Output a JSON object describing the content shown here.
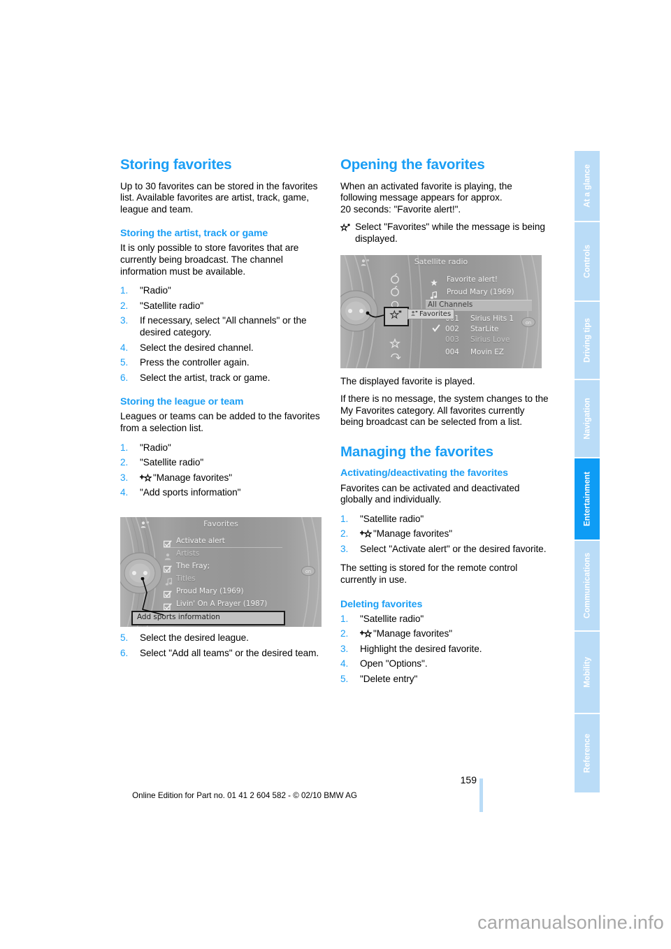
{
  "document": {
    "page_number": "159",
    "footer_text": "Online Edition for Part no. 01 41 2 604 582 - © 02/10 BMW AG",
    "watermark": "carmanualsonline.info"
  },
  "sidebar": {
    "tabs": [
      {
        "label": "At a glance",
        "active": false
      },
      {
        "label": "Controls",
        "active": false
      },
      {
        "label": "Driving tips",
        "active": false
      },
      {
        "label": "Navigation",
        "active": false
      },
      {
        "label": "Entertainment",
        "active": true
      },
      {
        "label": "Communications",
        "active": false
      },
      {
        "label": "Mobility",
        "active": false
      },
      {
        "label": "Reference",
        "active": false
      }
    ]
  },
  "left_column": {
    "heading": "Storing favorites",
    "intro": "Up to 30 favorites can be stored in the favorites list. Available favorites are artist, track, game, league and team.",
    "sub1": {
      "heading": "Storing the artist, track or game",
      "body": "It is only possible to store favorites that are currently being broadcast. The channel information must be available.",
      "steps": [
        "\"Radio\"",
        "\"Satellite radio\"",
        "If necessary, select \"All channels\" or the desired category.",
        "Select the desired channel.",
        "Press the controller again.",
        "Select the artist, track or game."
      ]
    },
    "sub2": {
      "heading": "Storing the league or team",
      "body": "Leagues or teams can be added to the favorites from a selection list.",
      "steps_a": [
        "\"Radio\"",
        "\"Satellite radio\"",
        "\"Manage favorites\"",
        "\"Add sports information\""
      ],
      "steps_b": [
        "Select the desired league.",
        "Select \"Add all teams\" or the desired team."
      ]
    }
  },
  "right_column": {
    "heading1": "Opening the favorites",
    "para1": "When an activated favorite is playing, the following message appears for approx.",
    "para1b": "20 seconds: \"Favorite alert!\".",
    "bullet1": "Select \"Favorites\" while the message is being displayed.",
    "para2": "The displayed favorite is played.",
    "para3": "If there is no message, the system changes to the My Favorites category. All favorites currently being broadcast can be selected from a list.",
    "heading2": "Managing the favorites",
    "sub1": {
      "heading": "Activating/deactivating the favorites",
      "body": "Favorites can be activated and deactivated globally and individually.",
      "steps": [
        "\"Satellite radio\"",
        "\"Manage favorites\"",
        "Select \"Activate alert\" or the desired favorite."
      ],
      "note": "The setting is stored for the remote control currently in use."
    },
    "sub2": {
      "heading": "Deleting favorites",
      "steps": [
        "\"Satellite radio\"",
        "\"Manage favorites\"",
        "Highlight the desired favorite.",
        "Open \"Options\".",
        "\"Delete entry\""
      ]
    }
  },
  "idrive_right": {
    "title": "Satellite radio",
    "message_rows": [
      {
        "icon": "star-icon",
        "text": "Favorite alert!"
      },
      {
        "icon": "music-note-icon",
        "text": "Proud Mary (1969)"
      }
    ],
    "category_bar": "All Channels",
    "tooltip": "Favorites",
    "channels": [
      {
        "num": "001",
        "name": "Sirius Hits 1",
        "checked": false
      },
      {
        "num": "002",
        "name": "StarLite",
        "checked": true
      },
      {
        "num": "003",
        "name": "Sirius Love",
        "checked": false
      },
      {
        "num": "004",
        "name": "Movin EZ",
        "checked": false
      }
    ],
    "side_icons": [
      "radio-icon",
      "cd-icon",
      "aux-icon",
      "settings-icon",
      "favorites-star-icon",
      "star-manage-icon",
      "back-icon"
    ],
    "on_label": "on"
  },
  "idrive_left": {
    "title": "Favorites",
    "rows": [
      {
        "icon": "checkbox-checked-icon",
        "text": "Activate alert"
      },
      {
        "icon": "artist-icon",
        "text": "Artists"
      },
      {
        "icon": "checkbox-checked-icon",
        "text": "The Fray;"
      },
      {
        "icon": "music-note-icon",
        "text": "Titles"
      },
      {
        "icon": "checkbox-checked-icon",
        "text": "Proud Mary (1969)"
      },
      {
        "icon": "checkbox-checked-icon",
        "text": "Livin' On A Prayer (1987)"
      }
    ],
    "selected_item": "Add sports information",
    "on_label": "on"
  },
  "colors": {
    "accent_blue": "#1a9ef5",
    "tab_blue": "#badcf7",
    "tab_active_blue": "#0e9cf5",
    "text_black": "#000000",
    "screen_gray": "#9b9b9b"
  }
}
